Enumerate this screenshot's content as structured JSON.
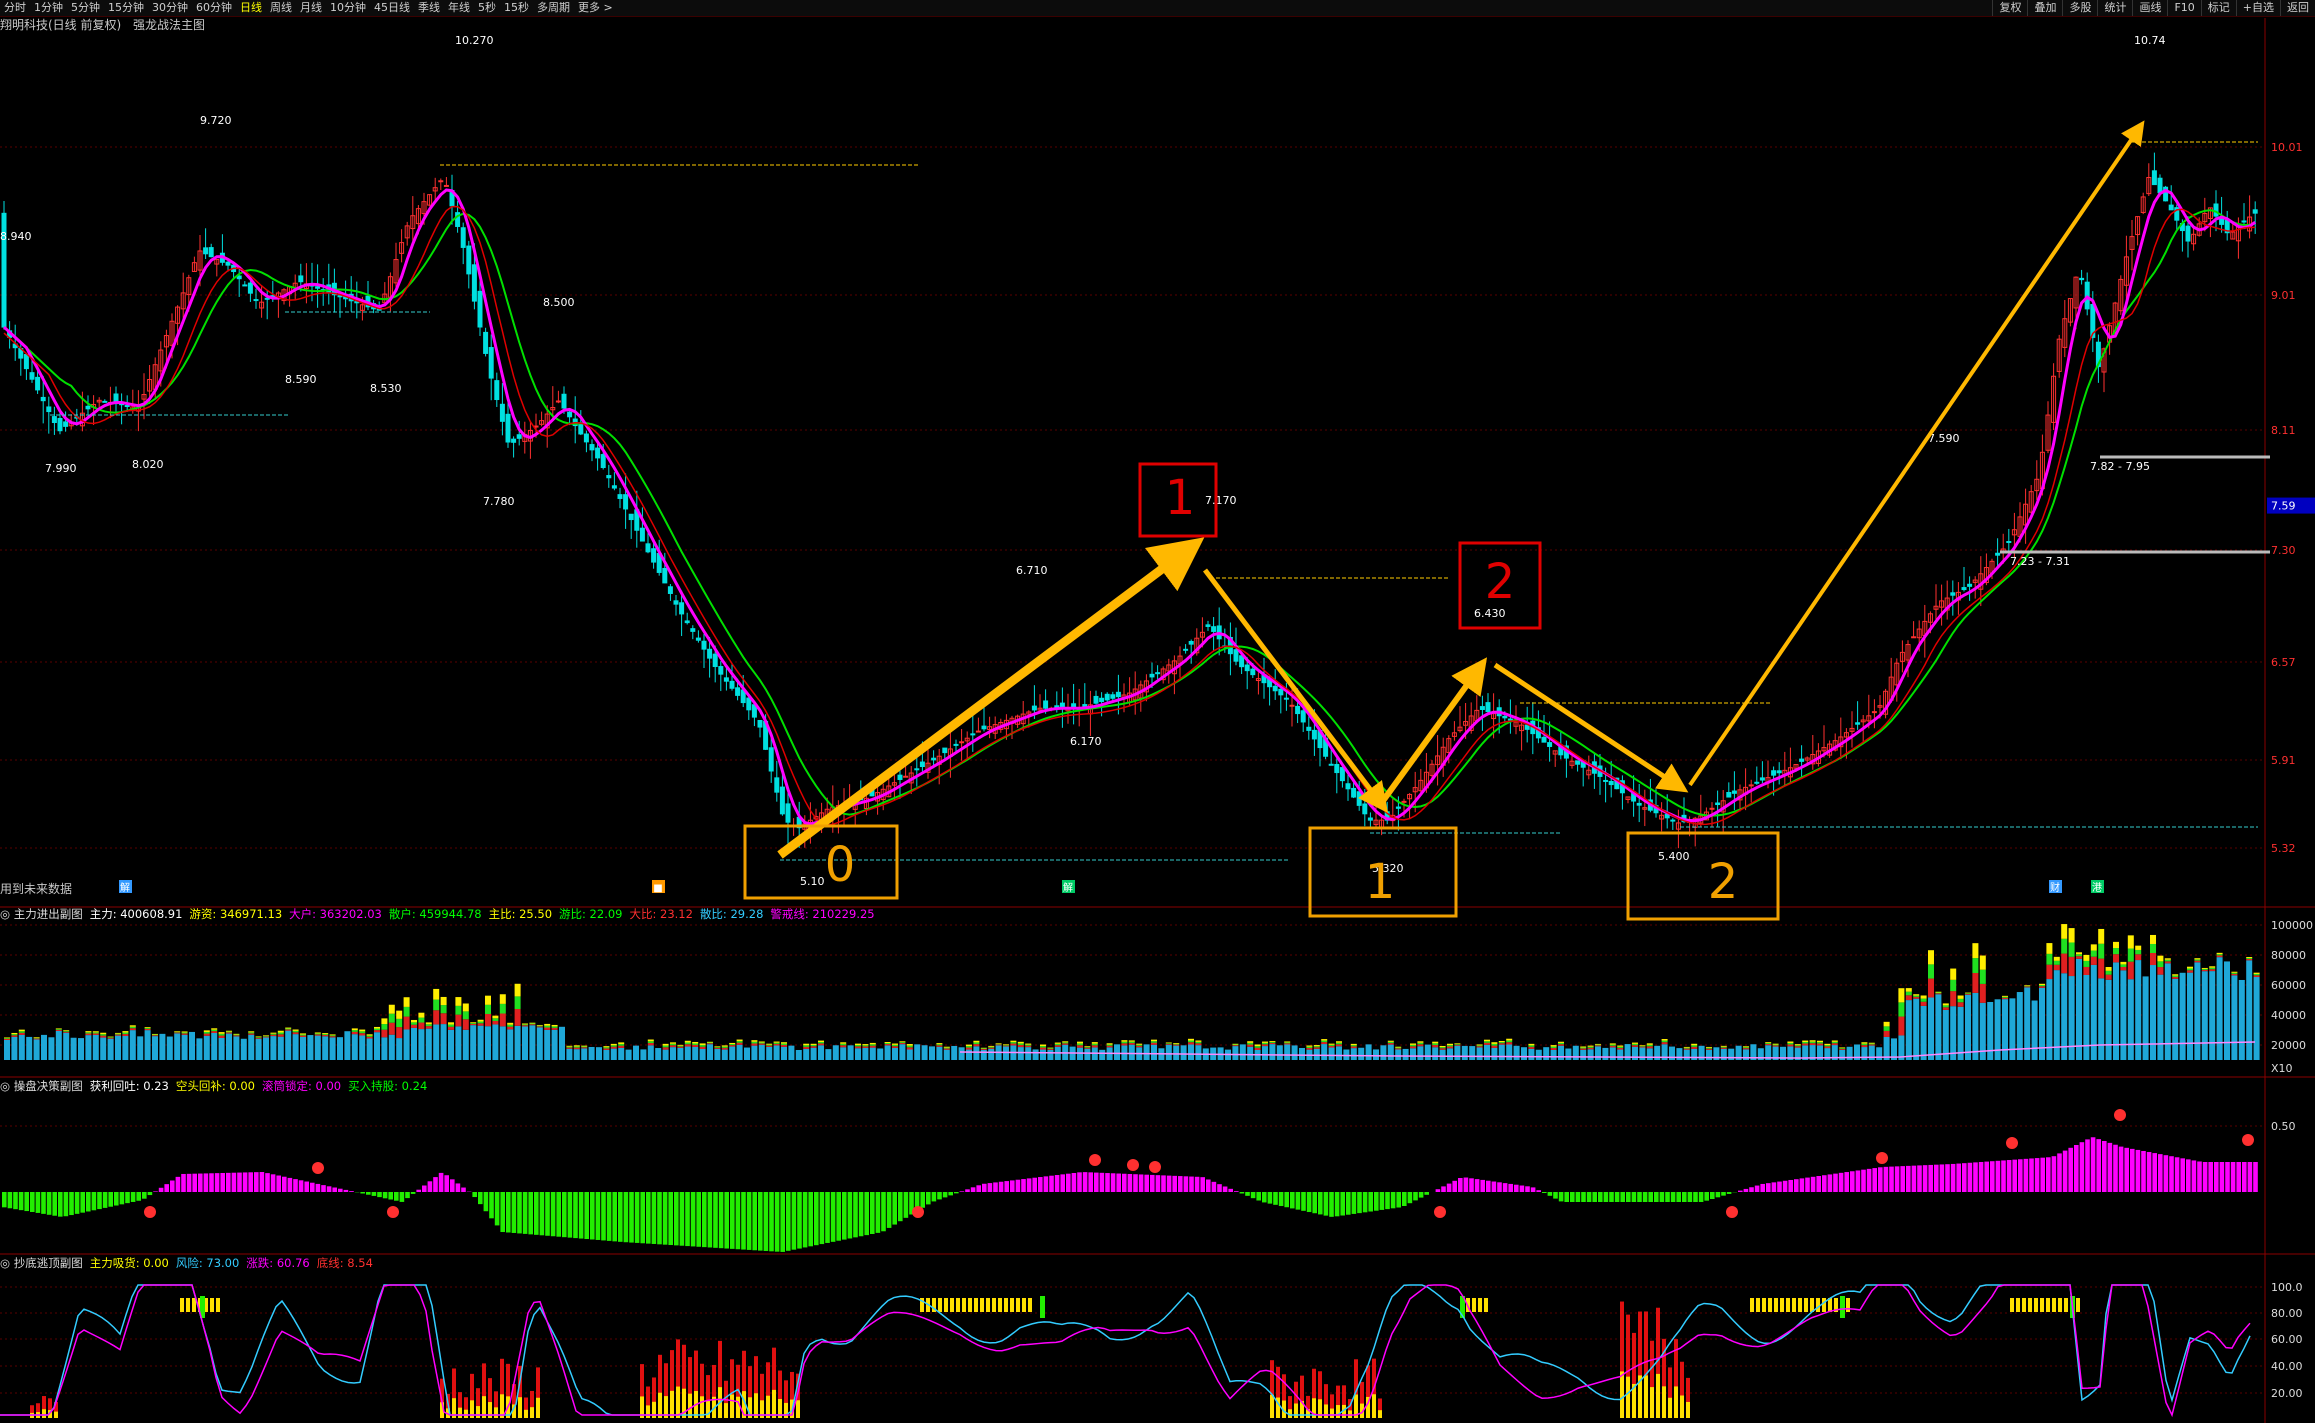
{
  "toolbar": {
    "periods": [
      "分时",
      "1分钟",
      "5分钟",
      "15分钟",
      "30分钟",
      "60分钟",
      "日线",
      "周线",
      "月线",
      "10分钟",
      "45日线",
      "季线",
      "年线",
      "5秒",
      "15秒",
      "多周期",
      "更多 >"
    ],
    "active_period": "日线",
    "right_buttons": [
      "复权",
      "叠加",
      "多股",
      "统计",
      "画线",
      "F10",
      "标记",
      "+自选",
      "返回"
    ]
  },
  "title": {
    "stock": "翔明科技(日线 前复权)",
    "indicator": "强龙战法主图",
    "future_note": "用到未来数据"
  },
  "main_chart": {
    "price_axis": [
      "10.01",
      "9.01",
      "8.11",
      "7.30",
      "6.57",
      "5.91",
      "5.32"
    ],
    "current_price": "7.59",
    "price_labels": [
      "10.270",
      "9.720",
      "8.940",
      "8.500",
      "8.590",
      "8.530",
      "7.990",
      "8.020",
      "7.780",
      "7.170",
      "6.710",
      "6.430",
      "6.170",
      "5.320",
      "5.400",
      "5.10",
      "7.590",
      "10.74",
      "7.82 - 7.95",
      "7.23 - 7.31"
    ],
    "pattern_boxes": [
      {
        "label": "0",
        "color": "#f0a000"
      },
      {
        "label": "1",
        "color": "#e00000"
      },
      {
        "label": "1",
        "color": "#f0a000"
      },
      {
        "label": "2",
        "color": "#e00000"
      },
      {
        "label": "2",
        "color": "#f0a000"
      }
    ],
    "event_markers": [
      "解",
      "财",
      "财",
      "港"
    ]
  },
  "panel1": {
    "title": "主力进出副图",
    "fields": [
      {
        "label": "主力: 400608.91",
        "color": "#ffffff"
      },
      {
        "label": "游资: 346971.13",
        "color": "#ffff00"
      },
      {
        "label": "大户: 363202.03",
        "color": "#ff00ff"
      },
      {
        "label": "散户: 459944.78",
        "color": "#00ff00"
      },
      {
        "label": "主比: 25.50",
        "color": "#ffff00"
      },
      {
        "label": "游比: 22.09",
        "color": "#00ff00"
      },
      {
        "label": "大比: 23.12",
        "color": "#ff3030"
      },
      {
        "label": "散比: 29.28",
        "color": "#33ccff"
      },
      {
        "label": "警戒线: 210229.25",
        "color": "#ff00ff"
      }
    ],
    "axis": [
      "100000",
      "80000",
      "60000",
      "40000",
      "20000",
      "X10"
    ]
  },
  "panel2": {
    "title": "操盘决策副图",
    "fields": [
      {
        "label": "获利回吐: 0.23",
        "color": "#ffffff"
      },
      {
        "label": "空头回补: 0.00",
        "color": "#ffff00"
      },
      {
        "label": "滚筒锁定: 0.00",
        "color": "#ff00ff"
      },
      {
        "label": "买入持股: 0.24",
        "color": "#00ff00"
      }
    ],
    "axis": [
      "0.50"
    ]
  },
  "panel3": {
    "title": "抄底逃顶副图",
    "fields": [
      {
        "label": "主力吸货: 0.00",
        "color": "#ffff00"
      },
      {
        "label": "风险: 73.00",
        "color": "#33ccff"
      },
      {
        "label": "涨跌: 60.76",
        "color": "#ff00ff"
      },
      {
        "label": "底线: 8.54",
        "color": "#ff3030"
      }
    ],
    "axis": [
      "100.0",
      "80.00",
      "60.00",
      "40.00",
      "20.00"
    ]
  },
  "colors": {
    "up": "#ff3030",
    "down": "#00e0e0",
    "green": "#00e000",
    "magenta": "#ff00ff",
    "arrow": "#ffb800",
    "grid": "#5a0000"
  }
}
